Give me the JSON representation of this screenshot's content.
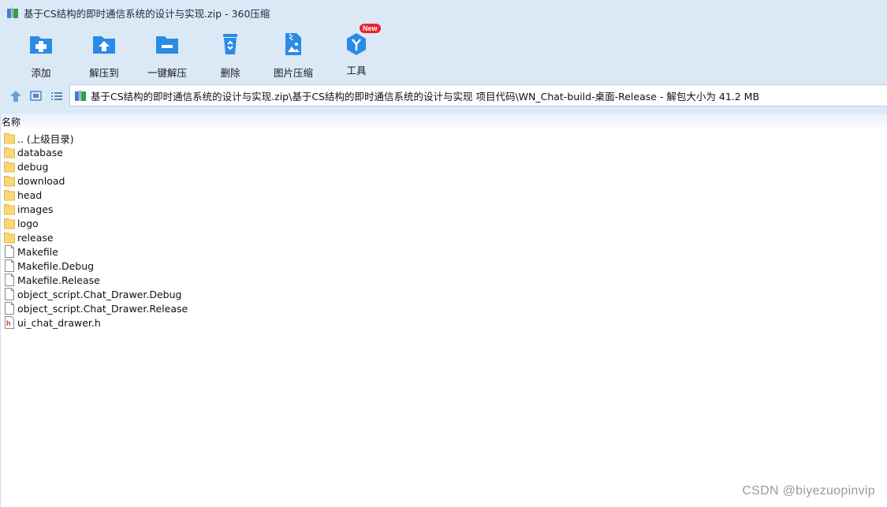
{
  "window": {
    "title": "基于CS结构的即时通信系统的设计与实现.zip - 360压缩"
  },
  "toolbar": {
    "buttons": [
      {
        "label": "添加",
        "icon": "add-icon"
      },
      {
        "label": "解压到",
        "icon": "extract-to-icon"
      },
      {
        "label": "一键解压",
        "icon": "one-click-extract-icon"
      },
      {
        "label": "删除",
        "icon": "delete-icon"
      },
      {
        "label": "图片压缩",
        "icon": "image-compress-icon"
      },
      {
        "label": "工具",
        "icon": "tools-icon",
        "badge": "New"
      }
    ],
    "accent": "#2a8be6"
  },
  "address": {
    "path": "基于CS结构的即时通信系统的设计与实现.zip\\基于CS结构的即时通信系统的设计与实现 项目代码\\WN_Chat-build-桌面-Release - 解包大小为 41.2 MB"
  },
  "list": {
    "column_name": "名称",
    "items": [
      {
        "name": ".. (上级目录)",
        "type": "folder"
      },
      {
        "name": "database",
        "type": "folder"
      },
      {
        "name": "debug",
        "type": "folder"
      },
      {
        "name": "download",
        "type": "folder"
      },
      {
        "name": "head",
        "type": "folder"
      },
      {
        "name": "images",
        "type": "folder"
      },
      {
        "name": "logo",
        "type": "folder"
      },
      {
        "name": "release",
        "type": "folder"
      },
      {
        "name": "Makefile",
        "type": "file"
      },
      {
        "name": "Makefile.Debug",
        "type": "file"
      },
      {
        "name": "Makefile.Release",
        "type": "file"
      },
      {
        "name": "object_script.Chat_Drawer.Debug",
        "type": "file"
      },
      {
        "name": "object_script.Chat_Drawer.Release",
        "type": "file"
      },
      {
        "name": "ui_chat_drawer.h",
        "type": "header"
      }
    ]
  },
  "watermark": "CSDN @biyezuopinvip"
}
